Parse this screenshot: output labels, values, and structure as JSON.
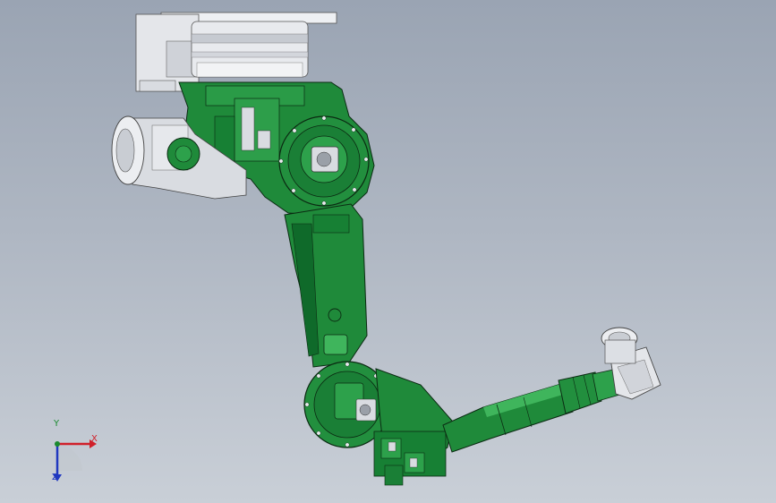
{
  "viewport": {
    "background_top": "#9aa4b3",
    "background_bottom": "#c9cfd7"
  },
  "model": {
    "name_icon": "robot-arm-model",
    "part_colors": {
      "body": "#1f8a3a",
      "body_dark": "#0f5a22",
      "body_light": "#3fb55c",
      "mount": "#e4e6ea",
      "mount_shade": "#b8bcc4",
      "motor": "#d9dce1",
      "outline": "#0b2a12"
    }
  },
  "triad": {
    "x_label": "X",
    "y_label": "Y",
    "z_label": "Z",
    "x_color": "#d0202a",
    "y_color": "#1a8a2e",
    "z_color": "#2038c0"
  }
}
